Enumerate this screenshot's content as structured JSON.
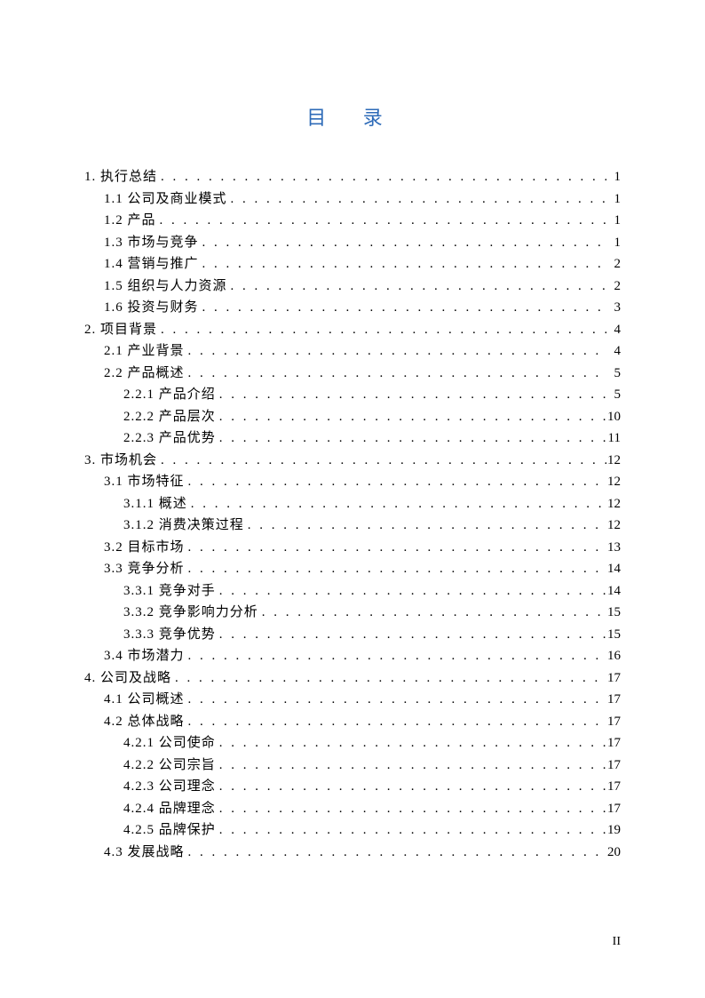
{
  "title": "目 录",
  "pageNumber": "II",
  "entries": [
    {
      "level": 0,
      "label": "1. 执行总结",
      "page": "1"
    },
    {
      "level": 1,
      "label": "1.1 公司及商业模式",
      "page": "1"
    },
    {
      "level": 1,
      "label": "1.2 产品",
      "page": "1"
    },
    {
      "level": 1,
      "label": "1.3 市场与竞争",
      "page": "1"
    },
    {
      "level": 1,
      "label": "1.4 营销与推广",
      "page": "2"
    },
    {
      "level": 1,
      "label": "1.5 组织与人力资源",
      "page": "2"
    },
    {
      "level": 1,
      "label": "1.6 投资与财务",
      "page": "3"
    },
    {
      "level": 0,
      "label": "2. 项目背景",
      "page": "4"
    },
    {
      "level": 1,
      "label": "2.1 产业背景",
      "page": "4"
    },
    {
      "level": 1,
      "label": "2.2 产品概述",
      "page": "5"
    },
    {
      "level": 2,
      "label": "2.2.1 产品介绍",
      "page": "5"
    },
    {
      "level": 2,
      "label": "2.2.2 产品层次",
      "page": "10"
    },
    {
      "level": 2,
      "label": "2.2.3 产品优势",
      "page": "11"
    },
    {
      "level": 0,
      "label": "3. 市场机会",
      "page": "12"
    },
    {
      "level": 1,
      "label": "3.1 市场特征",
      "page": "12"
    },
    {
      "level": 2,
      "label": "3.1.1 概述",
      "page": "12"
    },
    {
      "level": 2,
      "label": "3.1.2 消费决策过程",
      "page": "12"
    },
    {
      "level": 1,
      "label": "3.2 目标市场",
      "page": "13"
    },
    {
      "level": 1,
      "label": "3.3 竞争分析",
      "page": "14"
    },
    {
      "level": 2,
      "label": "3.3.1 竞争对手",
      "page": "14"
    },
    {
      "level": 2,
      "label": "3.3.2 竞争影响力分析",
      "page": "15"
    },
    {
      "level": 2,
      "label": "3.3.3 竞争优势",
      "page": "15"
    },
    {
      "level": 1,
      "label": "3.4 市场潜力",
      "page": "16"
    },
    {
      "level": 0,
      "label": "4. 公司及战略",
      "page": "17"
    },
    {
      "level": 1,
      "label": "4.1 公司概述",
      "page": "17"
    },
    {
      "level": 1,
      "label": "4.2 总体战略",
      "page": "17"
    },
    {
      "level": 2,
      "label": "4.2.1 公司使命",
      "page": "17"
    },
    {
      "level": 2,
      "label": "4.2.2 公司宗旨",
      "page": "17"
    },
    {
      "level": 2,
      "label": "4.2.3 公司理念",
      "page": "17"
    },
    {
      "level": 2,
      "label": "4.2.4 品牌理念",
      "page": "17"
    },
    {
      "level": 2,
      "label": "4.2.5 品牌保护",
      "page": "19"
    },
    {
      "level": 1,
      "label": "4.3 发展战略",
      "page": "20"
    }
  ]
}
